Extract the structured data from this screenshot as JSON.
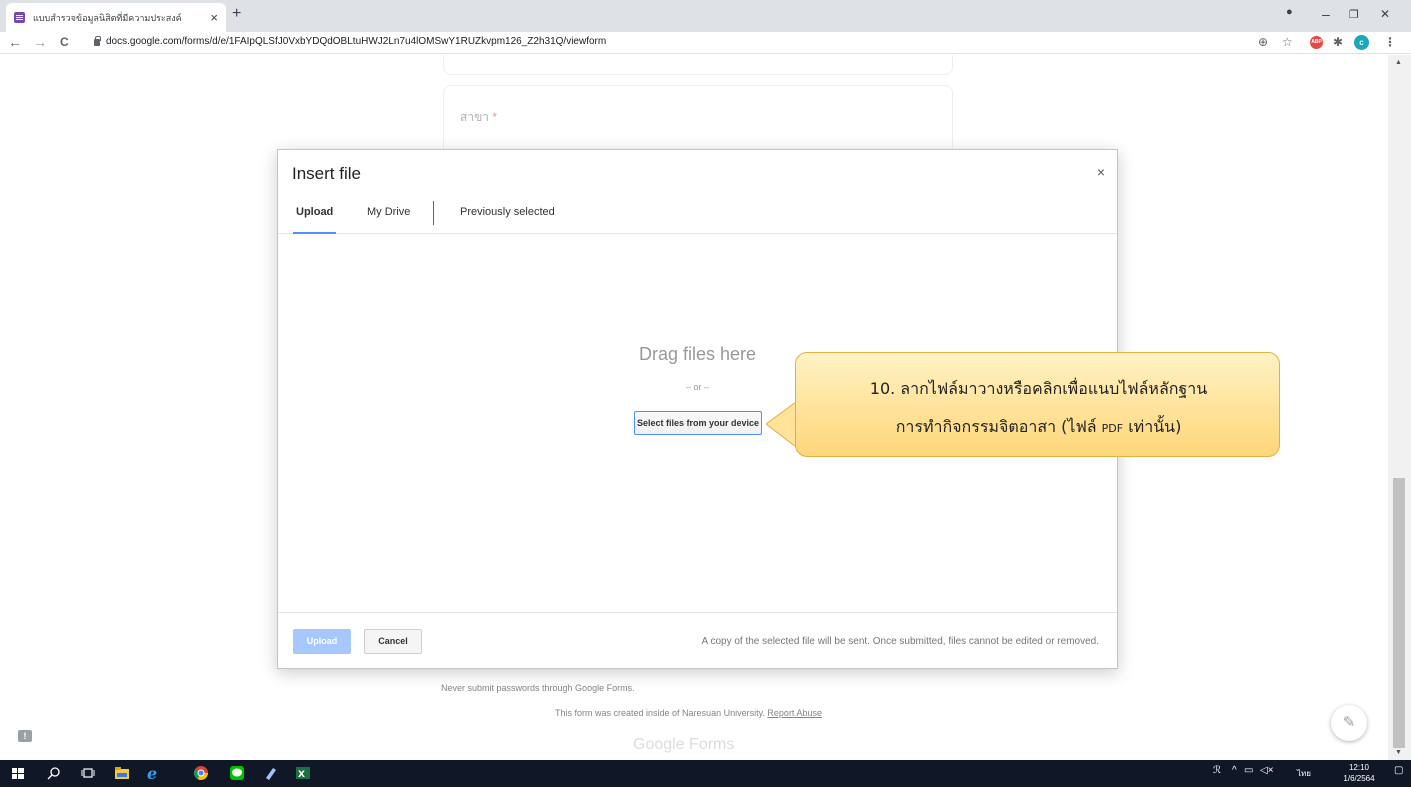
{
  "browser": {
    "tab_title": "แบบสำรวจข้อมูลนิสิตที่มีความประสงค์",
    "tab_close": "×",
    "new_tab": "+",
    "url": "docs.google.com/forms/d/e/1FAIpQLSfJ0VxbYDQdOBLtuHWJ2Ln7u4lOMSwY1RUZkvpm126_Z2h31Q/viewform",
    "back": "←",
    "forward": "→",
    "reload": "C",
    "zoom": "⊕",
    "star": "☆",
    "abp": "ABP",
    "puzzle": "✱",
    "profile": "c",
    "menu": "⋮",
    "minimize": "–",
    "restore": "❐",
    "close": "✕"
  },
  "form": {
    "field_label": "สาขา",
    "required_mark": " *",
    "note_passwords": "Never submit passwords through Google Forms.",
    "note_created": "This form was created inside of Naresuan University. ",
    "report_abuse": "Report Abuse",
    "brand": "Google Forms",
    "feedback": "!",
    "edit": "✎"
  },
  "dialog": {
    "title": "Insert file",
    "close": "×",
    "tabs": [
      "Upload",
      "My Drive",
      "Previously selected"
    ],
    "drag_text": "Drag files here",
    "or_text": "– or –",
    "select_button": "Select files from your device",
    "upload_button": "Upload",
    "cancel_button": "Cancel",
    "footer_message": "A copy of the selected file will be sent. Once submitted, files cannot be edited or removed."
  },
  "callout": {
    "line1": "10. ลากไฟล์มาวางหรือคลิกเพื่อแนบไฟล์หลักฐาน",
    "line2_a": "การทำกิจกรรมจิตอาสา (ไฟล์ ",
    "line2_small": "PDF",
    "line2_b": " เท่านั้น)"
  },
  "taskbar": {
    "lang": "ไทย",
    "time": "12:10",
    "date": "1/6/2564"
  },
  "colors": {
    "accent": "#4d90fe",
    "callout": "#ffd67a",
    "taskbar": "#101828"
  }
}
